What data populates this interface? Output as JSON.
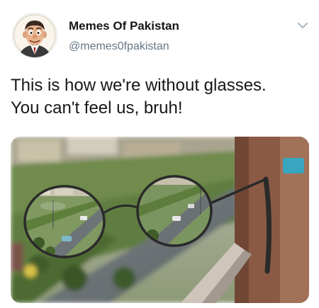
{
  "tweet": {
    "display_name": "Memes Of Pakistan",
    "handle": "@memes0fpakistan",
    "text_lines": [
      "This is how we're without glasses.",
      "You can't feel us, bruh!"
    ]
  },
  "icons": {
    "avatar": "cartoon-man-avatar",
    "menu": "chevron-down-icon"
  },
  "colors": {
    "text": "#14171a",
    "secondary_text": "#657786",
    "icon": "#aab8c2"
  }
}
